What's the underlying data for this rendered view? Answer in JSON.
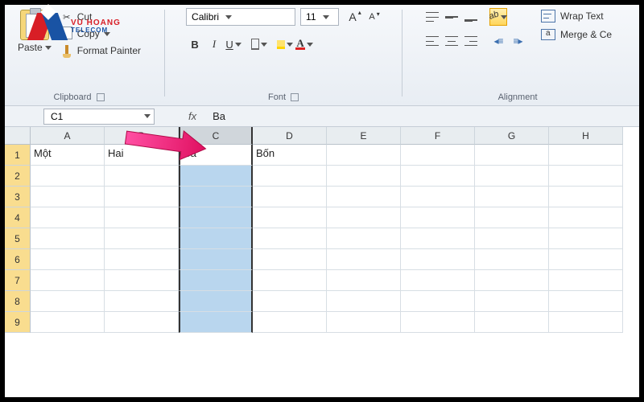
{
  "watermark": {
    "line1": "VU HOANG",
    "line2": "TELECOM"
  },
  "clipboard": {
    "paste": "Paste",
    "cut": "Cut",
    "copy": "Copy",
    "format_painter": "Format Painter",
    "group_label": "Clipboard"
  },
  "font": {
    "name": "Calibri",
    "size": "11",
    "group_label": "Font"
  },
  "alignment": {
    "wrap_text": "Wrap Text",
    "merge": "Merge & Ce",
    "group_label": "Alignment"
  },
  "namebox": {
    "ref": "C1",
    "formula": "Ba"
  },
  "columns": [
    "A",
    "B",
    "C",
    "D",
    "E",
    "F",
    "G",
    "H"
  ],
  "row_numbers": [
    "1",
    "2",
    "3",
    "4",
    "5",
    "6",
    "7",
    "8",
    "9"
  ],
  "cells": {
    "r1": {
      "A": "Một",
      "B": "Hai",
      "C": "Ba",
      "D": "Bốn"
    }
  },
  "selected_column": "C",
  "active_cell": "C1"
}
